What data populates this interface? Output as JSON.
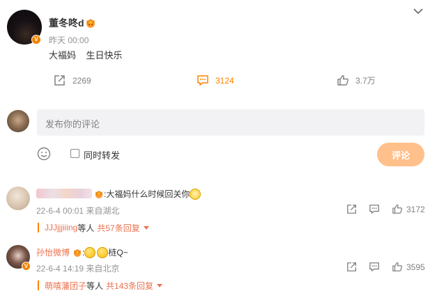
{
  "post": {
    "author": "董冬咚d",
    "verified_badge": "V",
    "time": "昨天 00:00",
    "text": "大福妈    生日快乐",
    "actions": {
      "share_count": "2269",
      "comment_count": "3124",
      "like_count": "3.7万"
    }
  },
  "composer": {
    "placeholder": "发布你的评论",
    "repost_label": "同时转发",
    "submit_label": "评论"
  },
  "comments": [
    {
      "text": ":大福妈什么时候回关你",
      "time": "22-6-4 00:01 来自湖北",
      "like_count": "3172",
      "reply_user": "JJJjjjiiing",
      "reply_mid": " 等人 ",
      "reply_more": "共57条回复"
    },
    {
      "username": "孙怡微博",
      "text": "梿Q~",
      "time": "22-6-4 14:19 来自北京",
      "verified_badge": "V",
      "like_count": "3595",
      "reply_user": "萌嘻藩团子",
      "reply_mid": " 等人 ",
      "reply_more": "共143条回复"
    }
  ],
  "colors": {
    "accent": "#ff8200",
    "link": "#eb7350",
    "submit_disabled": "#ffc08b"
  },
  "icons": [
    "chevron-down-icon",
    "crown-icon",
    "share-icon",
    "comment-icon",
    "like-icon",
    "smile-icon",
    "cat-emoji-icon",
    "emoji-icon"
  ]
}
